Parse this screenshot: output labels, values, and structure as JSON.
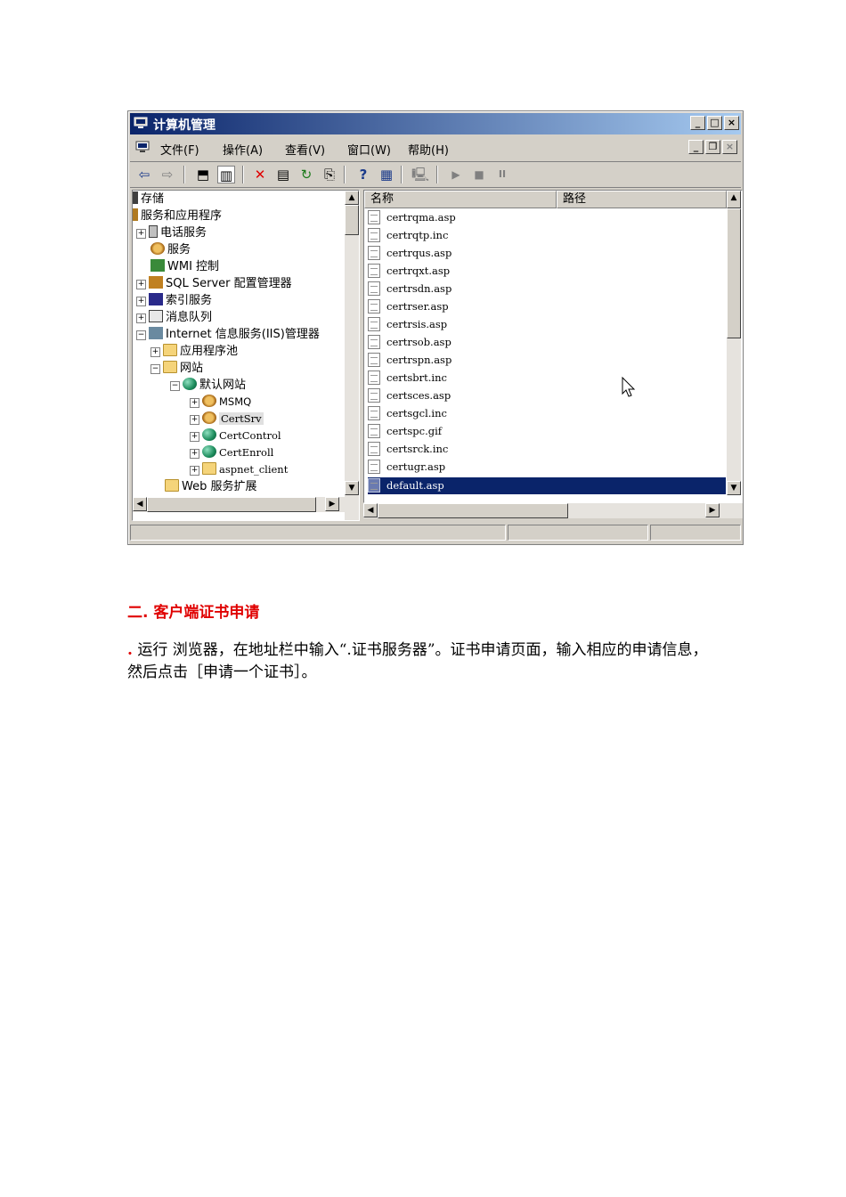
{
  "window": {
    "title": "计算机管理",
    "title_buttons": [
      "_",
      "□",
      "×"
    ]
  },
  "menu": [
    "文件(F)",
    "操作(A)",
    "查看(V)",
    "窗口(W)",
    "帮助(H)"
  ],
  "mdi_buttons": [
    "_",
    "❐",
    "×"
  ],
  "toolbar": {
    "back": "⇦",
    "forward": "⇨",
    "up": "⬒",
    "show_tree": "▥",
    "delete": "✕",
    "properties": "▤",
    "refresh": "↻",
    "export": "⎘",
    "help": "?",
    "console": "▦",
    "computer": "🖳",
    "start": "▶",
    "stop": "■",
    "pause": "II"
  },
  "tree": {
    "items": [
      {
        "label": "存储",
        "icon": "storage-icon"
      },
      {
        "label": "服务和应用程序",
        "icon": "services-apps-icon"
      },
      {
        "label": "电话服务",
        "icon": "telephony-icon"
      },
      {
        "label": "服务",
        "icon": "services-icon"
      },
      {
        "label": "WMI 控制",
        "icon": "wmi-icon"
      },
      {
        "label": "SQL Server 配置管理器",
        "icon": "sql-icon"
      },
      {
        "label": "索引服务",
        "icon": "indexing-icon"
      },
      {
        "label": "消息队列",
        "icon": "message-queue-icon"
      },
      {
        "label": "Internet 信息服务(IIS)管理器",
        "icon": "iis-icon"
      },
      {
        "label": "应用程序池",
        "icon": "folder-icon"
      },
      {
        "label": "网站",
        "icon": "folder-icon"
      },
      {
        "label": "默认网站",
        "icon": "globe-icon"
      },
      {
        "label": "MSMQ",
        "icon": "gear-icon"
      },
      {
        "label": "CertSrv",
        "icon": "gear-icon"
      },
      {
        "label": "CertControl",
        "icon": "globe-icon"
      },
      {
        "label": "CertEnroll",
        "icon": "globe-icon"
      },
      {
        "label": "aspnet_client",
        "icon": "folder-icon"
      },
      {
        "label": "Web 服务扩展",
        "icon": "folder-icon"
      }
    ]
  },
  "list": {
    "columns": [
      "名称",
      "路径"
    ],
    "files": [
      "certrqma.asp",
      "certrqtp.inc",
      "certrqus.asp",
      "certrqxt.asp",
      "certrsdn.asp",
      "certrser.asp",
      "certrsis.asp",
      "certrsob.asp",
      "certrspn.asp",
      "certsbrt.inc",
      "certsces.asp",
      "certsgcl.inc",
      "certspc.gif",
      "certsrck.inc",
      "certugr.asp",
      "default.asp"
    ],
    "selected": "default.asp"
  },
  "section": {
    "heading": "二. 客户端证书申请",
    "bullet": ".",
    "paragraph": "运行 浏览器，在地址栏中输入“.证书服务器”。证书申请页面，输入相应的申请信息，然后点击［申请一个证书］。"
  }
}
